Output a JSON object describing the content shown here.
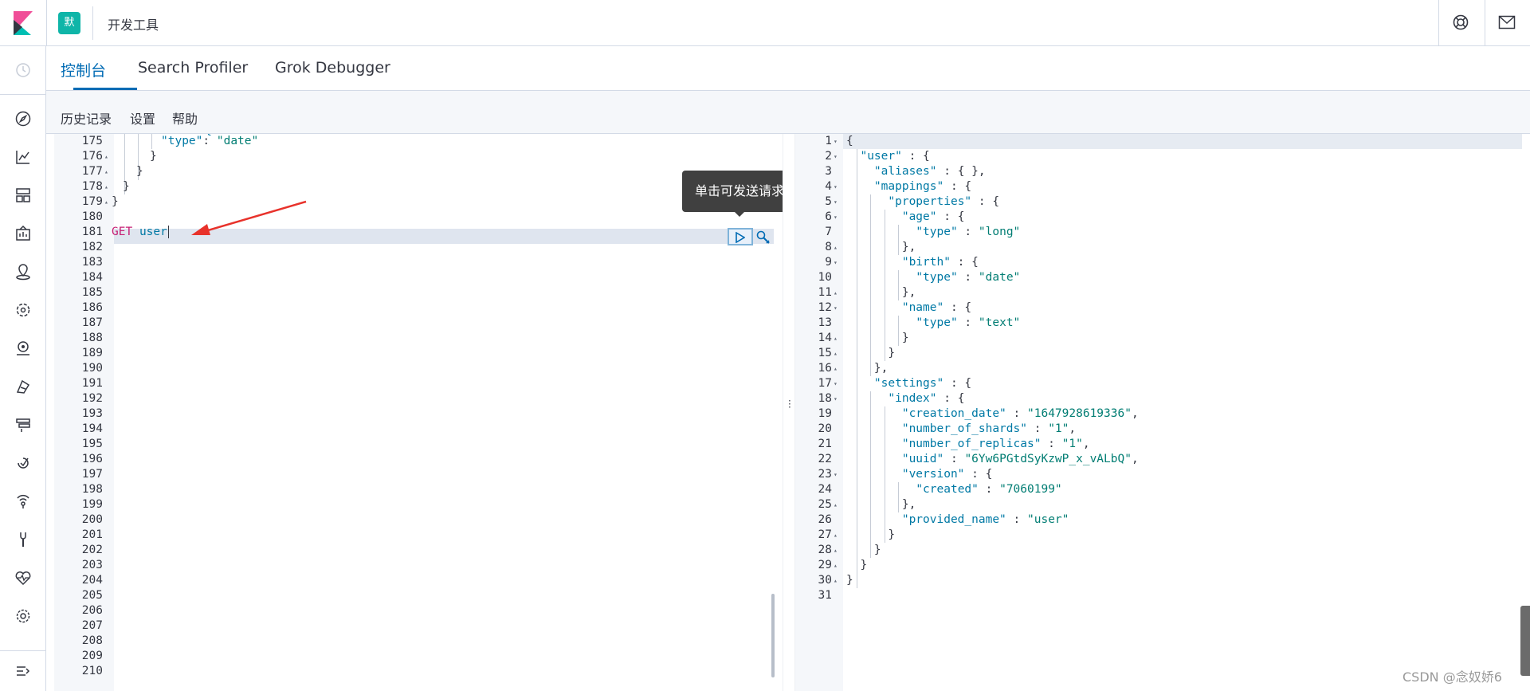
{
  "header": {
    "space_initial": "默",
    "breadcrumb": "开发工具",
    "help_icon": "help-icon",
    "mail_icon": "mail-icon"
  },
  "tabs": [
    {
      "label": "控制台",
      "active": true
    },
    {
      "label": "Search Profiler",
      "active": false
    },
    {
      "label": "Grok Debugger",
      "active": false
    }
  ],
  "console_menu": {
    "history": "历史记录",
    "settings": "设置",
    "help": "帮助"
  },
  "request_editor": {
    "lines": [
      {
        "n": "175",
        "fold": "",
        "text": "\"type\": \"date\""
      },
      {
        "n": "176",
        "fold": "▴",
        "text": "}"
      },
      {
        "n": "177",
        "fold": "▴",
        "text": "}"
      },
      {
        "n": "178",
        "fold": "▴",
        "text": "}"
      },
      {
        "n": "179",
        "fold": "▴",
        "text": "}"
      },
      {
        "n": "180",
        "fold": "",
        "text": ""
      },
      {
        "n": "181",
        "fold": "",
        "text": "GET user"
      },
      {
        "n": "182",
        "fold": "",
        "text": ""
      },
      {
        "n": "183",
        "fold": "",
        "text": ""
      },
      {
        "n": "184",
        "fold": "",
        "text": ""
      },
      {
        "n": "185",
        "fold": "",
        "text": ""
      },
      {
        "n": "186",
        "fold": "",
        "text": ""
      },
      {
        "n": "187",
        "fold": "",
        "text": ""
      },
      {
        "n": "188",
        "fold": "",
        "text": ""
      },
      {
        "n": "189",
        "fold": "",
        "text": ""
      },
      {
        "n": "190",
        "fold": "",
        "text": ""
      },
      {
        "n": "191",
        "fold": "",
        "text": ""
      },
      {
        "n": "192",
        "fold": "",
        "text": ""
      },
      {
        "n": "193",
        "fold": "",
        "text": ""
      },
      {
        "n": "194",
        "fold": "",
        "text": ""
      },
      {
        "n": "195",
        "fold": "",
        "text": ""
      },
      {
        "n": "196",
        "fold": "",
        "text": ""
      },
      {
        "n": "197",
        "fold": "",
        "text": ""
      },
      {
        "n": "198",
        "fold": "",
        "text": ""
      },
      {
        "n": "199",
        "fold": "",
        "text": ""
      },
      {
        "n": "200",
        "fold": "",
        "text": ""
      },
      {
        "n": "201",
        "fold": "",
        "text": ""
      },
      {
        "n": "202",
        "fold": "",
        "text": ""
      },
      {
        "n": "203",
        "fold": "",
        "text": ""
      },
      {
        "n": "204",
        "fold": "",
        "text": ""
      },
      {
        "n": "205",
        "fold": "",
        "text": ""
      },
      {
        "n": "206",
        "fold": "",
        "text": ""
      },
      {
        "n": "207",
        "fold": "",
        "text": ""
      },
      {
        "n": "208",
        "fold": "",
        "text": ""
      },
      {
        "n": "209",
        "fold": "",
        "text": ""
      },
      {
        "n": "210",
        "fold": "",
        "text": ""
      }
    ],
    "method": "GET",
    "path": "user",
    "send_tooltip": "单击可发送请求"
  },
  "response_editor": {
    "lines": [
      {
        "n": "1",
        "fold": "▾",
        "html": "{"
      },
      {
        "n": "2",
        "fold": "▾",
        "html": "  \"user\" : {"
      },
      {
        "n": "3",
        "fold": "",
        "html": "    \"aliases\" : { },"
      },
      {
        "n": "4",
        "fold": "▾",
        "html": "    \"mappings\" : {"
      },
      {
        "n": "5",
        "fold": "▾",
        "html": "      \"properties\" : {"
      },
      {
        "n": "6",
        "fold": "▾",
        "html": "        \"age\" : {"
      },
      {
        "n": "7",
        "fold": "",
        "html": "          \"type\" : \"long\""
      },
      {
        "n": "8",
        "fold": "▴",
        "html": "        },"
      },
      {
        "n": "9",
        "fold": "▾",
        "html": "        \"birth\" : {"
      },
      {
        "n": "10",
        "fold": "",
        "html": "          \"type\" : \"date\""
      },
      {
        "n": "11",
        "fold": "▴",
        "html": "        },"
      },
      {
        "n": "12",
        "fold": "▾",
        "html": "        \"name\" : {"
      },
      {
        "n": "13",
        "fold": "",
        "html": "          \"type\" : \"text\""
      },
      {
        "n": "14",
        "fold": "▴",
        "html": "        }"
      },
      {
        "n": "15",
        "fold": "▴",
        "html": "      }"
      },
      {
        "n": "16",
        "fold": "▴",
        "html": "    },"
      },
      {
        "n": "17",
        "fold": "▾",
        "html": "    \"settings\" : {"
      },
      {
        "n": "18",
        "fold": "▾",
        "html": "      \"index\" : {"
      },
      {
        "n": "19",
        "fold": "",
        "html": "        \"creation_date\" : \"1647928619336\","
      },
      {
        "n": "20",
        "fold": "",
        "html": "        \"number_of_shards\" : \"1\","
      },
      {
        "n": "21",
        "fold": "",
        "html": "        \"number_of_replicas\" : \"1\","
      },
      {
        "n": "22",
        "fold": "",
        "html": "        \"uuid\" : \"6Yw6PGtdSyKzwP_x_vALbQ\","
      },
      {
        "n": "23",
        "fold": "▾",
        "html": "        \"version\" : {"
      },
      {
        "n": "24",
        "fold": "",
        "html": "          \"created\" : \"7060199\""
      },
      {
        "n": "25",
        "fold": "▴",
        "html": "        },"
      },
      {
        "n": "26",
        "fold": "",
        "html": "        \"provided_name\" : \"user\""
      },
      {
        "n": "27",
        "fold": "▴",
        "html": "      }"
      },
      {
        "n": "28",
        "fold": "▴",
        "html": "    }"
      },
      {
        "n": "29",
        "fold": "▴",
        "html": "  }"
      },
      {
        "n": "30",
        "fold": "▴",
        "html": "}"
      },
      {
        "n": "31",
        "fold": "",
        "html": ""
      }
    ]
  },
  "watermark": "CSDN @念奴娇6",
  "colors": {
    "accent": "#006bb4",
    "json_key": "#0079a5",
    "json_string": "#017d73",
    "http_method": "#c61e73",
    "space_badge": "#0fb5a8",
    "annotation_arrow": "#e8322b"
  }
}
